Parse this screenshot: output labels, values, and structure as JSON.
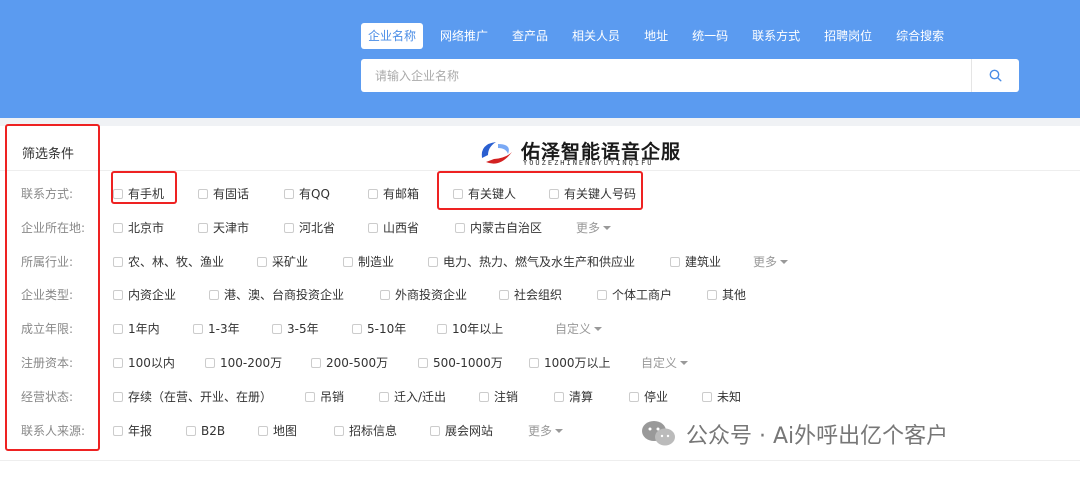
{
  "search": {
    "tabs": [
      {
        "label": "企业名称",
        "active": true
      },
      {
        "label": "网络推广",
        "active": false
      },
      {
        "label": "查产品",
        "active": false
      },
      {
        "label": "相关人员",
        "active": false
      },
      {
        "label": "地址",
        "active": false
      },
      {
        "label": "统一码",
        "active": false
      },
      {
        "label": "联系方式",
        "active": false
      },
      {
        "label": "招聘岗位",
        "active": false
      },
      {
        "label": "综合搜索",
        "active": false
      }
    ],
    "placeholder": "请输入企业名称",
    "value": ""
  },
  "filter": {
    "title": "筛选条件",
    "more_label": "更多",
    "custom_label": "自定义",
    "rows": [
      {
        "label": "联系方式:",
        "options": [
          "有手机",
          "有固话",
          "有QQ",
          "有邮箱",
          "有关键人",
          "有关键人号码"
        ]
      },
      {
        "label": "企业所在地:",
        "options": [
          "北京市",
          "天津市",
          "河北省",
          "山西省",
          "内蒙古自治区"
        ]
      },
      {
        "label": "所属行业:",
        "options": [
          "农、林、牧、渔业",
          "采矿业",
          "制造业",
          "电力、热力、燃气及水生产和供应业",
          "建筑业"
        ]
      },
      {
        "label": "企业类型:",
        "options": [
          "内资企业",
          "港、澳、台商投资企业",
          "外商投资企业",
          "社会组织",
          "个体工商户",
          "其他"
        ]
      },
      {
        "label": "成立年限:",
        "options": [
          "1年内",
          "1-3年",
          "3-5年",
          "5-10年",
          "10年以上"
        ]
      },
      {
        "label": "注册资本:",
        "options": [
          "100以内",
          "100-200万",
          "200-500万",
          "500-1000万",
          "1000万以上"
        ]
      },
      {
        "label": "经营状态:",
        "options": [
          "存续（在营、开业、在册）",
          "吊销",
          "迁入/迁出",
          "注销",
          "清算",
          "停业",
          "未知"
        ]
      },
      {
        "label": "联系人来源:",
        "options": [
          "年报",
          "B2B",
          "地图",
          "招标信息",
          "展会网站"
        ]
      }
    ]
  },
  "logo": {
    "name": "佑泽智能语音企服",
    "subtitle": "YOUZEZHINENGYUYINQIFU"
  },
  "watermark": {
    "text": "公众号 · Ai外呼出亿个客户"
  },
  "colors": {
    "header": "#5b9bf0",
    "accent": "#4a8de6",
    "highlight_box": "#e22222"
  }
}
